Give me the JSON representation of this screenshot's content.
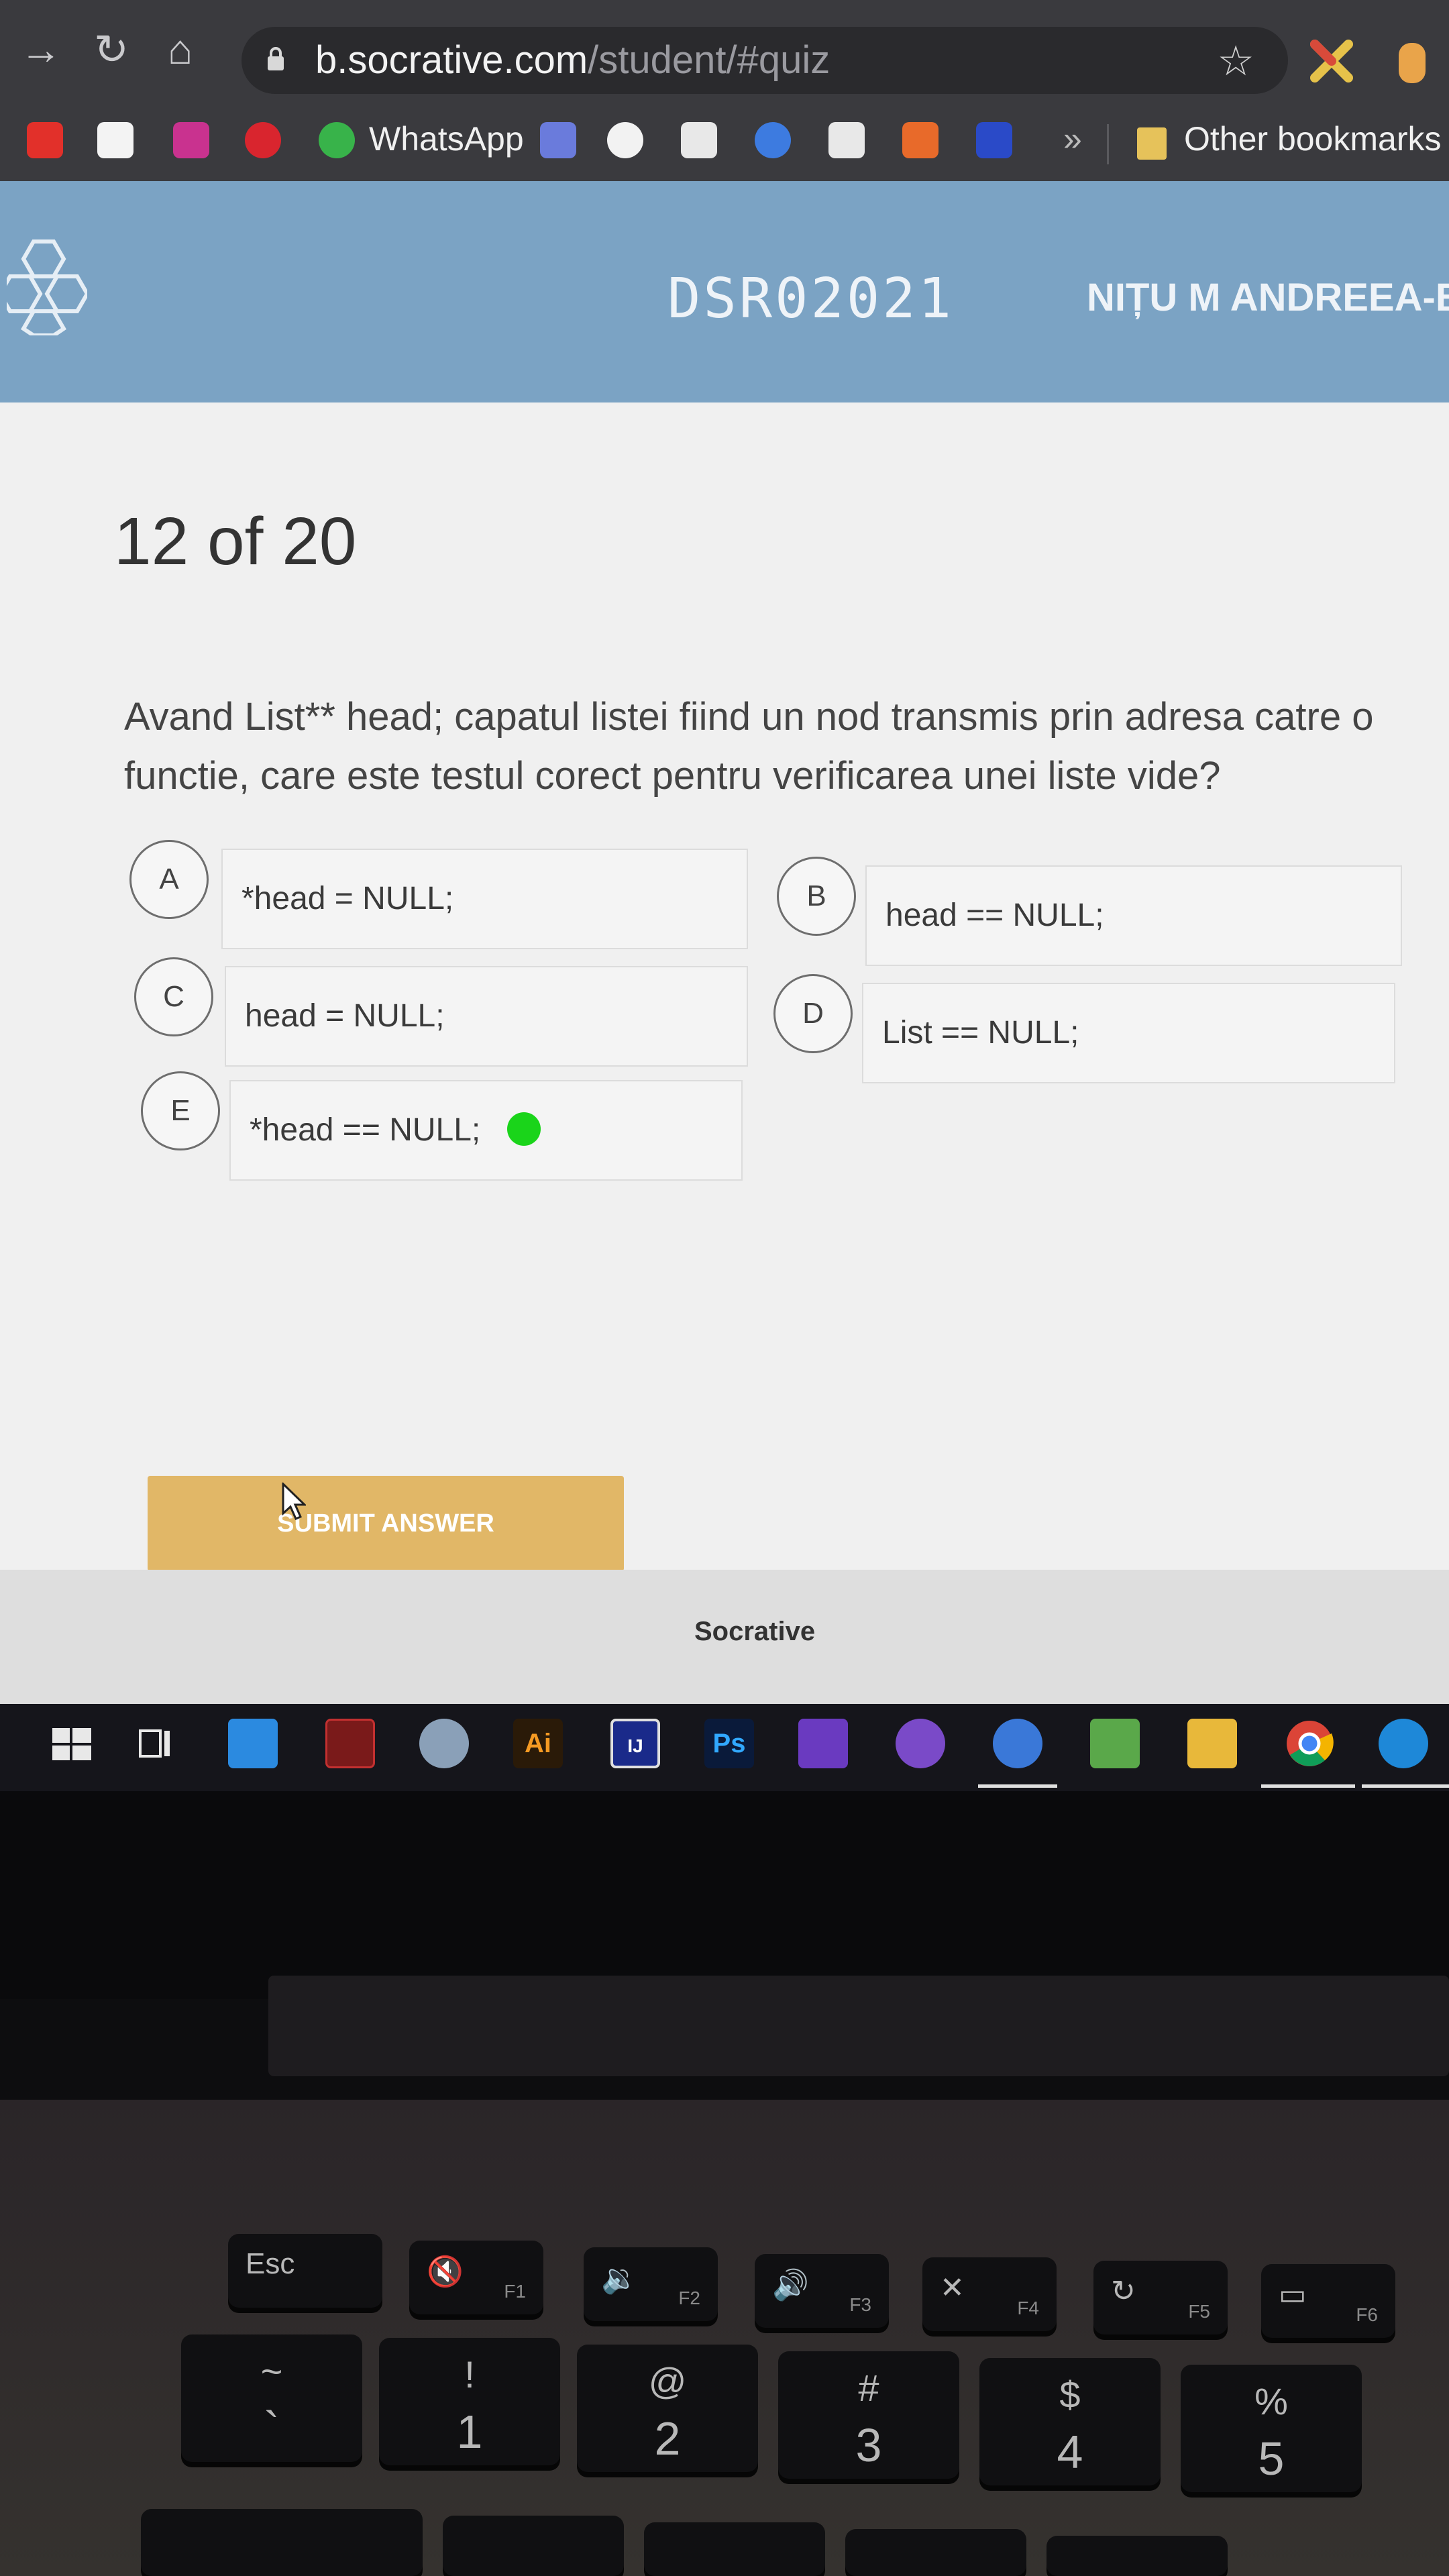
{
  "browser": {
    "url_host": "b.socrative.com",
    "url_path": "/student/#quiz",
    "bookmarks": {
      "whatsapp": "WhatsApp",
      "overflow": "»",
      "other": "Other bookmarks"
    }
  },
  "header": {
    "class_code": "DSR02021",
    "student_name": "NIȚU M ANDREEA-BI"
  },
  "quiz": {
    "progress": "12 of 20",
    "question": "Avand List** head; capatul listei fiind un nod transmis prin adresa catre o functie, care este testul corect pentru verificarea unei liste vide?",
    "answers": [
      {
        "letter": "A",
        "text": "*head = NULL;"
      },
      {
        "letter": "B",
        "text": "head == NULL;"
      },
      {
        "letter": "C",
        "text": "head = NULL;"
      },
      {
        "letter": "D",
        "text": "List == NULL;"
      },
      {
        "letter": "E",
        "text": "*head == NULL;"
      }
    ],
    "submit_label": "SUBMIT ANSWER"
  },
  "footer": {
    "brand": "Socrative"
  },
  "taskbar": {
    "ai_label": "Ai",
    "ij_label": "IJ",
    "ps_label": "Ps"
  },
  "keyboard": {
    "esc": "Esc",
    "f1": "F1",
    "f2": "F2",
    "f3": "F3",
    "f4": "F4",
    "f5": "F5",
    "f6": "F6",
    "row2": [
      {
        "top": "~",
        "bot": "`"
      },
      {
        "top": "!",
        "bot": "1"
      },
      {
        "top": "@",
        "bot": "2"
      },
      {
        "top": "#",
        "bot": "3"
      },
      {
        "top": "$",
        "bot": "4"
      },
      {
        "top": "%",
        "bot": "5"
      }
    ]
  },
  "colors": {
    "header_blue": "#7ba3c4",
    "submit_gold": "#e1b767",
    "selected_dot": "#1ad41a"
  }
}
